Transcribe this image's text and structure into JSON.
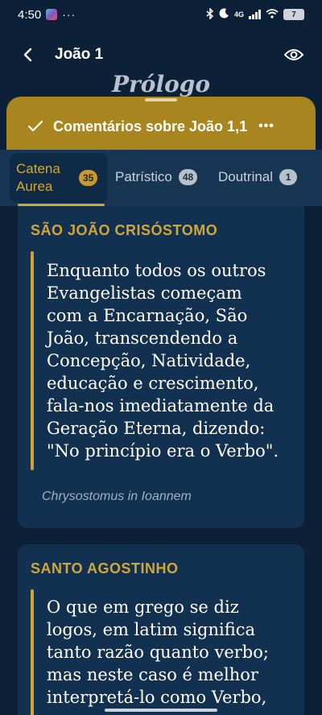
{
  "status_bar": {
    "time": "4:50",
    "dots": "···",
    "network": "4G",
    "battery": "7"
  },
  "header": {
    "title": "João 1",
    "back_icon": "chevron-left-icon",
    "eye_icon": "eye-icon"
  },
  "section_title": "Prólogo",
  "sheet": {
    "title": "Comentários sobre João 1,1",
    "more": "•••",
    "check_icon": "check-icon"
  },
  "tabs": [
    {
      "label": "Catena Aurea",
      "count": "35",
      "active": true
    },
    {
      "label": "Patrístico",
      "count": "48",
      "active": false
    },
    {
      "label": "Doutrinal",
      "count": "1",
      "active": false
    }
  ],
  "comments": [
    {
      "author": "SÃO JOÃO CRISÓSTOMO",
      "lines": [
        "Enquanto todos os outros",
        "Evangelistas começam",
        "com a Encarnação, São",
        "João, transcendendo a",
        "Concepção, Natividade,",
        "educação e crescimento,",
        "fala-nos imediatamente da",
        "Geração Eterna, dizendo:",
        "\"No princípio era o Verbo\"."
      ],
      "source": "Chrysostomus in Ioannem"
    },
    {
      "author": "SANTO AGOSTINHO",
      "lines": [
        "O que em grego se diz",
        "logos, em latim significa",
        "tanto razão quanto verbo;",
        "mas neste caso é melhor",
        "interpretá-lo como Verbo,"
      ]
    }
  ],
  "colors": {
    "background": "#0c2138",
    "gold": "#d4a82a",
    "sheet": "#a9851f",
    "card": "#123050"
  }
}
